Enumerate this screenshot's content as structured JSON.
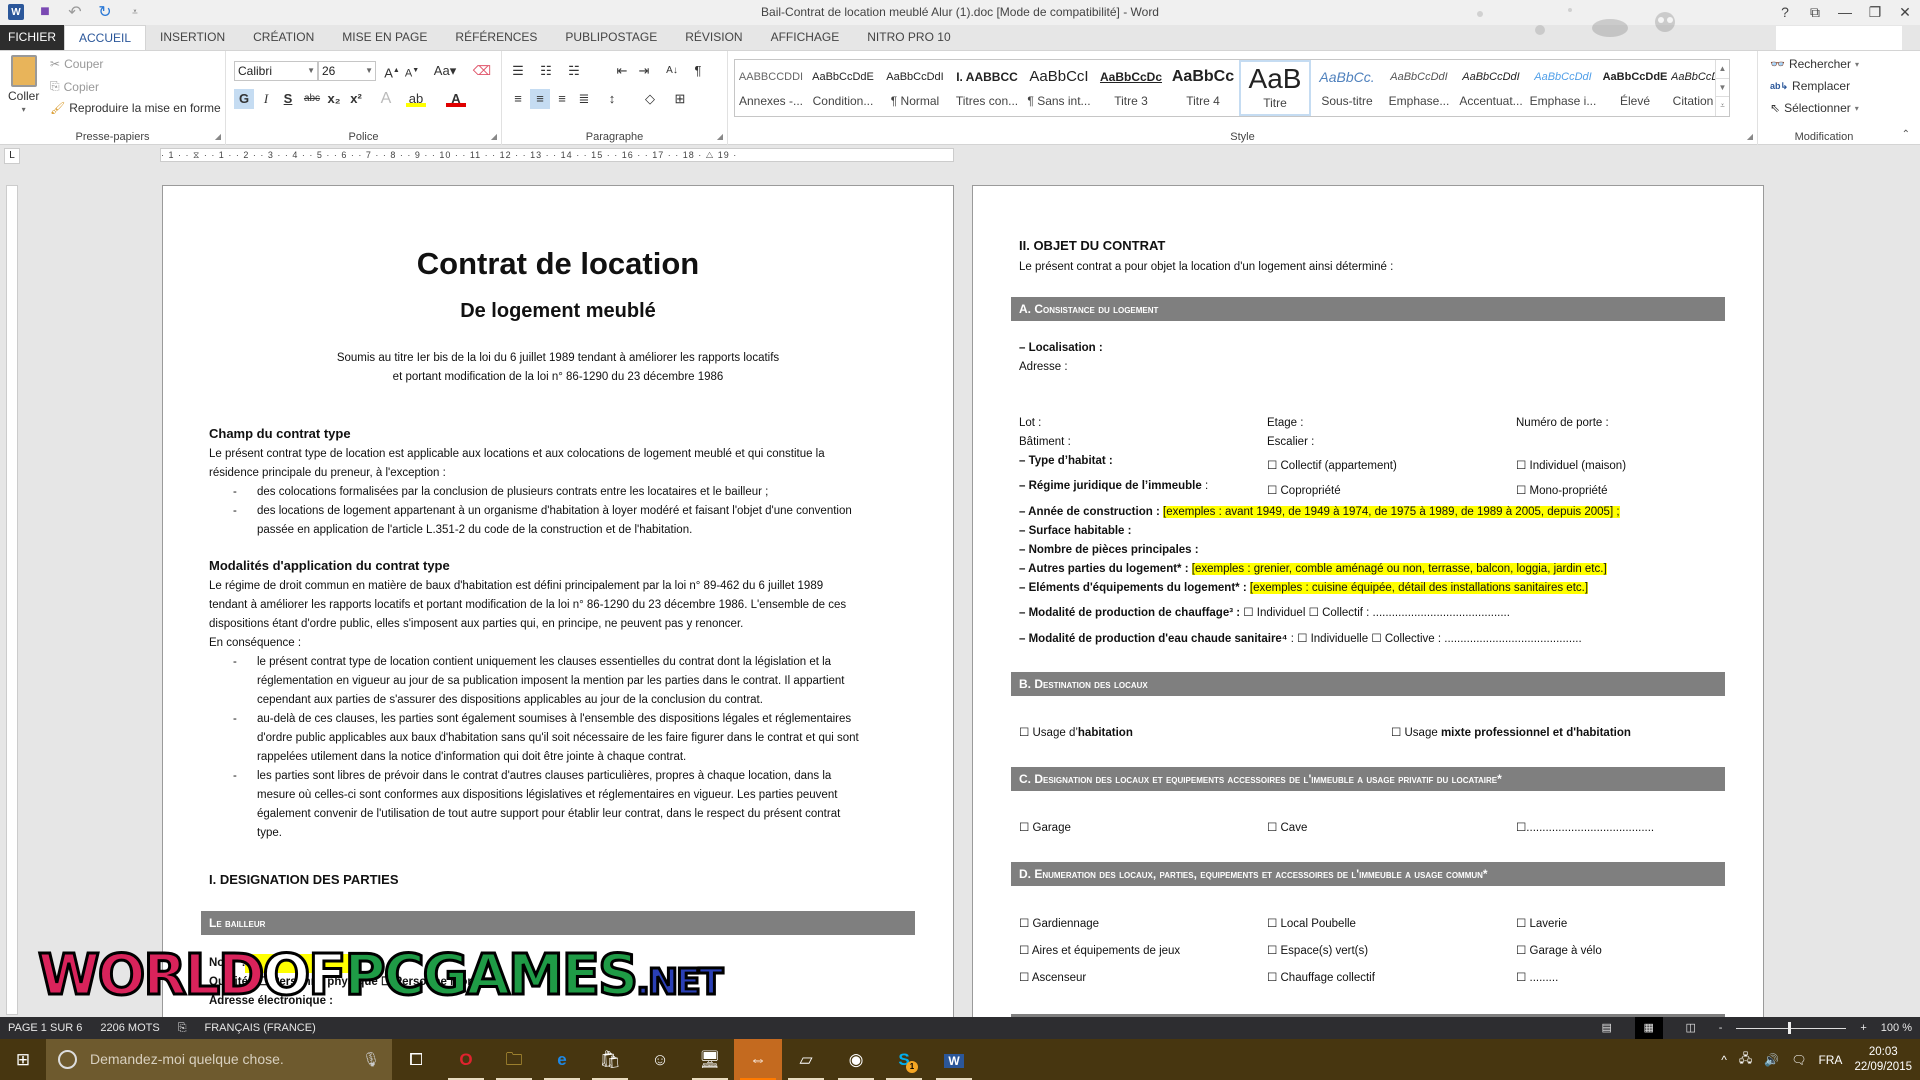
{
  "window": {
    "title": "Bail-Contrat de location meublé Alur (1).doc [Mode de compatibilité] - Word",
    "controls": [
      "?",
      "⧉",
      "—",
      "❐",
      "✕"
    ]
  },
  "qat": {
    "icons": [
      "word-logo",
      "save-icon",
      "undo-icon",
      "redo-icon",
      "customize-icon"
    ]
  },
  "tabs": [
    {
      "label": "FICHIER",
      "active": false
    },
    {
      "label": "ACCUEIL",
      "active": true
    },
    {
      "label": "INSERTION",
      "active": false
    },
    {
      "label": "CRÉATION",
      "active": false
    },
    {
      "label": "MISE EN PAGE",
      "active": false
    },
    {
      "label": "RÉFÉRENCES",
      "active": false
    },
    {
      "label": "PUBLIPOSTAGE",
      "active": false
    },
    {
      "label": "RÉVISION",
      "active": false
    },
    {
      "label": "AFFICHAGE",
      "active": false
    },
    {
      "label": "NITRO PRO 10",
      "active": false
    }
  ],
  "ribbon": {
    "clipboard": {
      "label": "Presse-papiers",
      "paste": "Coller",
      "cut": "Couper",
      "copy": "Copier",
      "format_painter": "Reproduire la mise en forme"
    },
    "font": {
      "label": "Police",
      "font_name": "Calibri",
      "font_size": "26",
      "bold": "G",
      "italic": "I",
      "underline": "S",
      "strikethrough": "abc",
      "subscript": "x₂",
      "superscript": "x²",
      "change_case": "Aa",
      "highlight_color": "#ffff00",
      "font_color": "#e00000"
    },
    "paragraph": {
      "label": "Paragraphe",
      "show_marks": "¶"
    },
    "styles": {
      "label": "Style",
      "items": [
        {
          "preview": "AABBCCDDI",
          "name": "Annexes -..."
        },
        {
          "preview": "AaBbCcDdE",
          "name": "Condition..."
        },
        {
          "preview": "AaBbCcDdI",
          "name": "¶ Normal"
        },
        {
          "preview": "I. AABBCC",
          "name": "Titres con..."
        },
        {
          "preview": "AaBbCcI",
          "name": "¶ Sans int..."
        },
        {
          "preview": "AaBbCcDc",
          "name": "Titre 3"
        },
        {
          "preview": "AaBbCc",
          "name": "Titre 4"
        },
        {
          "preview": "AaB",
          "name": "Titre",
          "selected": true
        },
        {
          "preview": "AaBbCc.",
          "name": "Sous-titre"
        },
        {
          "preview": "AaBbCcDdI",
          "name": "Emphase..."
        },
        {
          "preview": "AaBbCcDdI",
          "name": "Accentuat..."
        },
        {
          "preview": "AaBbCcDdI",
          "name": "Emphase i..."
        },
        {
          "preview": "AaBbCcDdE",
          "name": "Élevé"
        },
        {
          "preview": "AaBbCcDdI",
          "name": "Citation"
        }
      ]
    },
    "editing": {
      "label": "Modification",
      "find": "Rechercher",
      "replace": "Remplacer",
      "select": "Sélectionner"
    }
  },
  "ruler": {
    "marks": "· 1 · · ⧖ · · 1 · · 2 · · 3 · · 4 · · 5 · · 6 · · 7 · · 8 · · 9 · · 10 · · 11 · · 12 · · 13 · · 14 · · 15 · · 16 · · 17 · · 18 · △ 19 ·",
    "tab_selector": "L"
  },
  "page1": {
    "title": "Contrat de location",
    "subtitle": "De logement meublé",
    "intro1": "Soumis au titre Ier bis de la loi du 6 juillet 1989 tendant à améliorer les rapports locatifs",
    "intro2": "et portant modification de la loi n° 86-1290 du 23 décembre 1986",
    "s1_title": "Champ du contrat type",
    "s1_p1": "Le présent contrat type de location est applicable aux locations et aux colocations de logement meublé et qui constitue la",
    "s1_p2": "résidence principale du preneur, à l'exception :",
    "s1_b1": "des colocations formalisées par la conclusion de plusieurs contrats entre les locataires et le bailleur ;",
    "s1_b2a": "des locations de logement appartenant à un organisme d'habitation à loyer modéré et faisant l'objet d'une convention",
    "s1_b2b": "passée en application de l'article L.351-2 du code de la construction et de l'habitation.",
    "s2_title": "Modalités d'application du contrat type",
    "s2_p1": "Le régime de droit commun en matière de baux d'habitation est défini principalement par la loi n° 89-462 du 6 juillet 1989",
    "s2_p2": "tendant à améliorer les rapports locatifs et portant modification de la loi n° 86-1290 du 23 décembre 1986. L'ensemble de ces",
    "s2_p3": "dispositions étant d'ordre public, elles s'imposent aux parties qui, en principe, ne peuvent pas y renoncer.",
    "s2_p4": "En conséquence :",
    "s2_b1a": "le présent contrat type de location contient uniquement les clauses essentielles du contrat dont la législation et la",
    "s2_b1b": "réglementation en vigueur au jour de sa publication imposent la mention par les parties dans le contrat. Il appartient",
    "s2_b1c": "cependant aux parties de s'assurer des dispositions applicables au jour de la conclusion du contrat.",
    "s2_b2a": "au-delà de ces clauses, les parties sont également soumises à l'ensemble des dispositions légales et réglementaires",
    "s2_b2b": "d'ordre public applicables aux baux d'habitation sans qu'il soit nécessaire de les faire figurer dans le contrat et qui sont",
    "s2_b2c": "rappelées utilement dans la notice d'information qui doit être jointe à chaque contrat.",
    "s2_b3a": "les parties sont libres de prévoir dans le contrat d'autres clauses particulières, propres à chaque location, dans la",
    "s2_b3b": "mesure où celles-ci sont conformes aux dispositions législatives et réglementaires en vigueur. Les parties peuvent",
    "s2_b3c": "également convenir de l'utilisation de tout autre support pour établir leur contrat, dans le respect du présent contrat",
    "s2_b3d": "type.",
    "s3_title": "I. DESIGNATION DES PARTIES",
    "bar_bailleur": "Le bailleur",
    "nom": "Nom¹ :",
    "qualite": "Qualité : ☐ Personne physique ☐ Personne morale",
    "email": "Adresse électronique :"
  },
  "page2": {
    "title": "II. OBJET DU CONTRAT",
    "intro": "Le présent contrat a pour objet la location d'un logement ainsi déterminé :",
    "barA": "A. Consistance du logement",
    "localisation": "– Localisation :",
    "adresse": "Adresse :",
    "lot": "Lot :",
    "etage": "Etage :",
    "porte": "Numéro de porte :",
    "batiment": "Bâtiment :",
    "escalier": "Escalier :",
    "type_habitat": "– Type d’habitat :",
    "collectif": "☐ Collectif (appartement)",
    "individuel": "☐ Individuel (maison)",
    "regime": "– Régime juridique de l’immeuble",
    "regime_colon": " :",
    "copro": "☐ Copropriété",
    "mono": "☐ Mono-propriété",
    "annee": "– Année de construction :",
    "annee_ex": "[exemples : avant 1949, de 1949 à 1974, de 1975 à 1989, de 1989 à 2005, depuis 2005] ;",
    "surface": "– Surface habitable :",
    "pieces": "– Nombre de pièces principales :",
    "autres": "– Autres parties du logement* :",
    "autres_ex": "[exemples : grenier, comble aménagé ou non, terrasse, balcon, loggia, jardin etc.]",
    "equip": "– Eléments d'équipements du logement* :",
    "equip_ex": "[exemples : cuisine équipée, détail des installations sanitaires etc.]",
    "chauffage": "– Modalité de production de chauffage³ :",
    "chauffage_opts": "☐ Individuel  ☐ Collectif : ...........................................",
    "eau": "– Modalité de production d'eau chaude sanitaire⁴",
    "eau_opts": " : ☐ Individuelle  ☐ Collective : ...........................................",
    "barB": "B. Destination des locaux",
    "usage1_pre": "☐ Usage d’",
    "usage1_b": "habitation",
    "usage2_pre": "☐ Usage ",
    "usage2_b": "mixte professionnel et d'habitation",
    "barC": "C. Designation des locaux et equipements accessoires de l'immeuble a usage privatif du locataire*",
    "c_items": [
      "☐ Garage",
      "☐ Cave",
      "☐........................................"
    ],
    "barD": "D. Enumeration des locaux, parties, equipements et accessoires de l'immeuble a usage commun*",
    "d_items": [
      "☐ Gardiennage",
      "☐ Local Poubelle",
      "☐ Laverie",
      "☐ Aires et équipements de jeux",
      "☐ Espace(s) vert(s)",
      "☐ Garage à vélo",
      "☐ Ascenseur",
      "☐ Chauffage collectif",
      "☐ ........."
    ]
  },
  "statusbar": {
    "page": "PAGE 1 SUR 6",
    "words": "2206 MOTS",
    "language": "FRANÇAIS (FRANCE)",
    "zoom": "100 %",
    "zoom_value_percent": 100
  },
  "taskbar": {
    "search_placeholder": "Demandez-moi quelque chose.",
    "apps": [
      "task-view",
      "opera",
      "file-explorer",
      "edge",
      "store",
      "app-6",
      "remote-desktop",
      "teamviewer",
      "notepad",
      "steam",
      "skype",
      "word"
    ],
    "active_app": "teamviewer",
    "skype_badge": "1",
    "lang": "FRA",
    "time": "20:03",
    "date": "22/09/2015"
  },
  "watermark": {
    "part1": "WORLD",
    "part2": "OF",
    "part3": "PCGAMES",
    "part4": ".NET"
  }
}
